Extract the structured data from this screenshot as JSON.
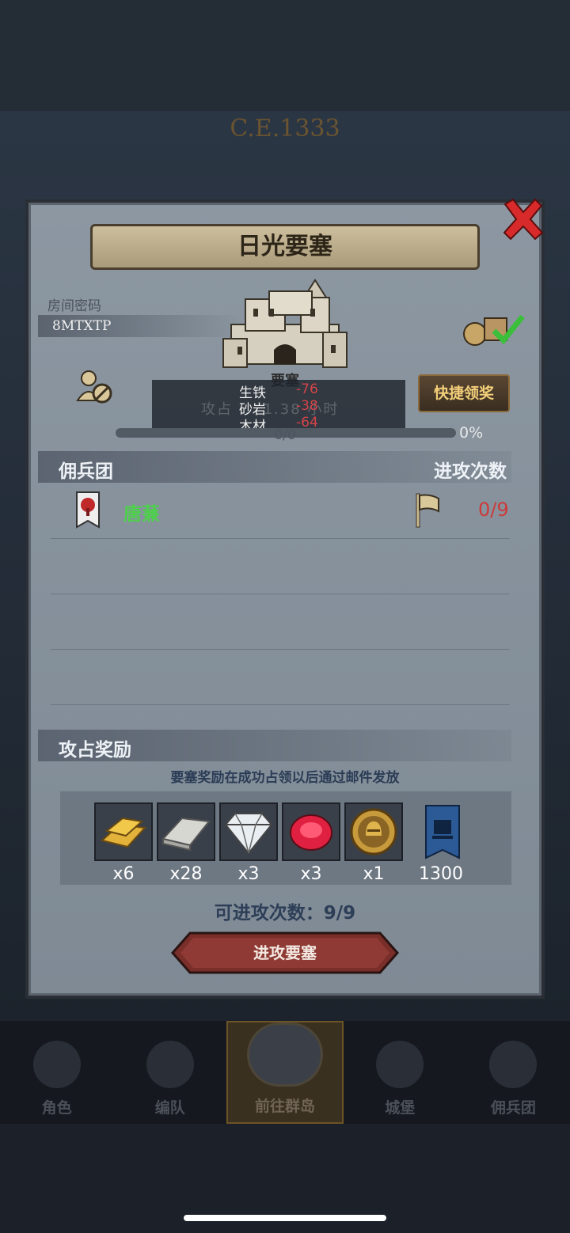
{
  "era": "C.E.1333",
  "dialog": {
    "title": "日光要塞",
    "room_label": "房间密码",
    "room_code": "8MTXTP",
    "castle_label": "要塞",
    "quick_claim": "快捷领奖",
    "resources": [
      {
        "name": "生铁",
        "value": "-76"
      },
      {
        "name": "砂岩",
        "value": "-38"
      },
      {
        "name": "木材",
        "value": "-64"
      }
    ],
    "faint_info": "攻占 ... 1.38 小时",
    "progress": {
      "label": "0/0",
      "percent": "0%",
      "value": 0
    }
  },
  "mercenary": {
    "header_left": "佣兵团",
    "header_right": "进攻次数",
    "rows": [
      {
        "name": "唐蒹",
        "count": "0/9"
      }
    ]
  },
  "reward": {
    "header": "攻占奖励",
    "note": "要塞奖励在成功占领以后通过邮件发放",
    "items": [
      {
        "icon": "gold-bar-icon",
        "qty": "x6"
      },
      {
        "icon": "silver-bar-icon",
        "qty": "x28"
      },
      {
        "icon": "diamond-icon",
        "qty": "x3"
      },
      {
        "icon": "ruby-icon",
        "qty": "x3"
      },
      {
        "icon": "knight-coin-icon",
        "qty": "x1"
      },
      {
        "icon": "fortress-banner-icon",
        "qty": "1300"
      }
    ]
  },
  "attacks_available": "可进攻次数：9/9",
  "attack_button": "进攻要塞",
  "bottom_nav": [
    "角色",
    "编队",
    "前往群岛",
    "城堡",
    "佣兵团"
  ],
  "colors": {
    "accent_gold": "#f3cf7a",
    "merc_green": "#4ed04c",
    "alert_red": "#cc3a3a"
  }
}
